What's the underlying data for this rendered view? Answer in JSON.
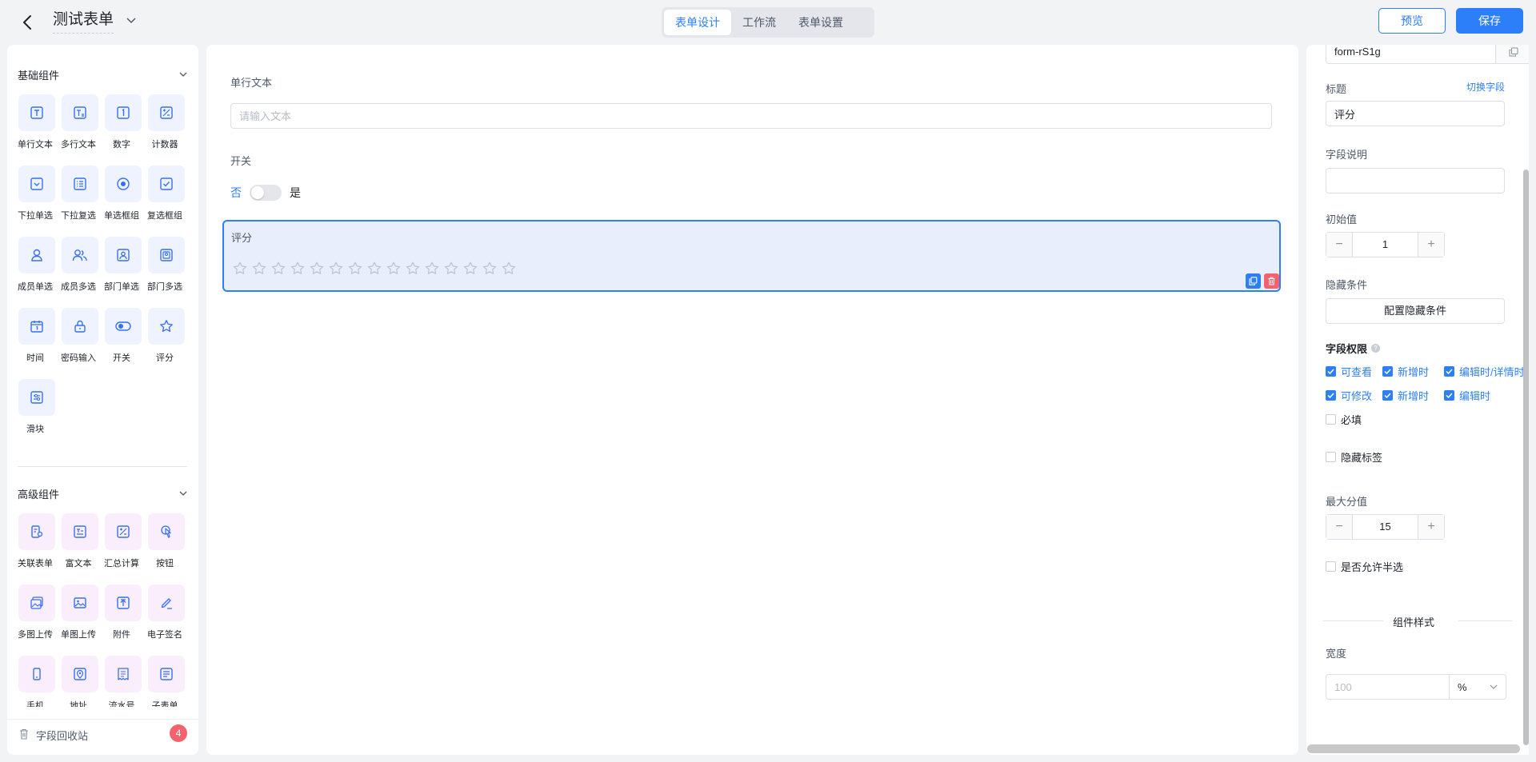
{
  "header": {
    "title": "测试表单",
    "tabs": [
      {
        "label": "表单设计",
        "active": true
      },
      {
        "label": "工作流",
        "active": false
      },
      {
        "label": "表单设置",
        "active": false
      }
    ],
    "preview_label": "预览",
    "save_label": "保存"
  },
  "left_panel": {
    "basic": {
      "title": "基础组件",
      "items": [
        {
          "label": "单行文本",
          "icon": "single-line-text-icon"
        },
        {
          "label": "多行文本",
          "icon": "multi-line-text-icon"
        },
        {
          "label": "数字",
          "icon": "number-icon"
        },
        {
          "label": "计数器",
          "icon": "calculator-icon"
        },
        {
          "label": "下拉单选",
          "icon": "dropdown-select-icon"
        },
        {
          "label": "下拉复选",
          "icon": "dropdown-multi-icon"
        },
        {
          "label": "单选框组",
          "icon": "radio-group-icon"
        },
        {
          "label": "复选框组",
          "icon": "checkbox-group-icon"
        },
        {
          "label": "成员单选",
          "icon": "member-icon"
        },
        {
          "label": "成员多选",
          "icon": "members-icon"
        },
        {
          "label": "部门单选",
          "icon": "department-icon"
        },
        {
          "label": "部门多选",
          "icon": "departments-icon"
        },
        {
          "label": "时间",
          "icon": "calendar-icon"
        },
        {
          "label": "密码输入",
          "icon": "lock-icon"
        },
        {
          "label": "开关",
          "icon": "toggle-icon"
        },
        {
          "label": "评分",
          "icon": "star-icon"
        },
        {
          "label": "滑块",
          "icon": "slider-icon"
        }
      ]
    },
    "advanced": {
      "title": "高级组件",
      "items": [
        {
          "label": "关联表单",
          "icon": "linked-form-icon"
        },
        {
          "label": "富文本",
          "icon": "rich-text-icon"
        },
        {
          "label": "汇总计算",
          "icon": "summary-calc-icon"
        },
        {
          "label": "按钮",
          "icon": "pointer-icon"
        },
        {
          "label": "多图上传",
          "icon": "images-upload-icon"
        },
        {
          "label": "单图上传",
          "icon": "image-upload-icon"
        },
        {
          "label": "附件",
          "icon": "attachment-icon"
        },
        {
          "label": "电子签名",
          "icon": "signature-icon"
        },
        {
          "label": "手机",
          "icon": "phone-icon"
        },
        {
          "label": "地址",
          "icon": "location-icon"
        },
        {
          "label": "流水号",
          "icon": "serial-number-icon"
        },
        {
          "label": "子表单",
          "icon": "subform-icon"
        }
      ]
    },
    "recycle": {
      "label": "字段回收站",
      "count": "4"
    }
  },
  "canvas": {
    "text_field": {
      "label": "单行文本",
      "placeholder": "请输入文本"
    },
    "switch_field": {
      "label": "开关",
      "off_text": "否",
      "on_text": "是"
    },
    "rating_field": {
      "label": "评分",
      "max": 15,
      "value": 0
    }
  },
  "properties": {
    "field_id": "form-rS1g",
    "title_label": "标题",
    "switch_field_link": "切换字段",
    "title_value": "评分",
    "desc_label": "字段说明",
    "desc_value": "",
    "initial_label": "初始值",
    "initial_value": "1",
    "hide_label": "隐藏条件",
    "hide_button": "配置隐藏条件",
    "perm_label": "字段权限",
    "perm_help": "?",
    "perm_row1": [
      {
        "label": "可查看",
        "checked": true
      },
      {
        "label": "新增时",
        "checked": true
      },
      {
        "label": "编辑时/详情时",
        "checked": true
      }
    ],
    "perm_row2": [
      {
        "label": "可修改",
        "checked": true
      },
      {
        "label": "新增时",
        "checked": true
      },
      {
        "label": "编辑时",
        "checked": true
      }
    ],
    "required_label": "必填",
    "required": false,
    "hide_tag_label": "隐藏标签",
    "hide_tag": false,
    "max_label": "最大分值",
    "max_value": "15",
    "half_label": "是否允许半选",
    "half": false,
    "style_divider": "组件样式",
    "width_label": "宽度",
    "width_placeholder": "100",
    "width_unit": "%"
  },
  "colors": {
    "accent": "#2d7ff9",
    "basic_tile": "#eef3ff",
    "advanced_tile": "#fbeefc",
    "selected_bg": "#e9eefc",
    "danger": "#f5616d"
  }
}
